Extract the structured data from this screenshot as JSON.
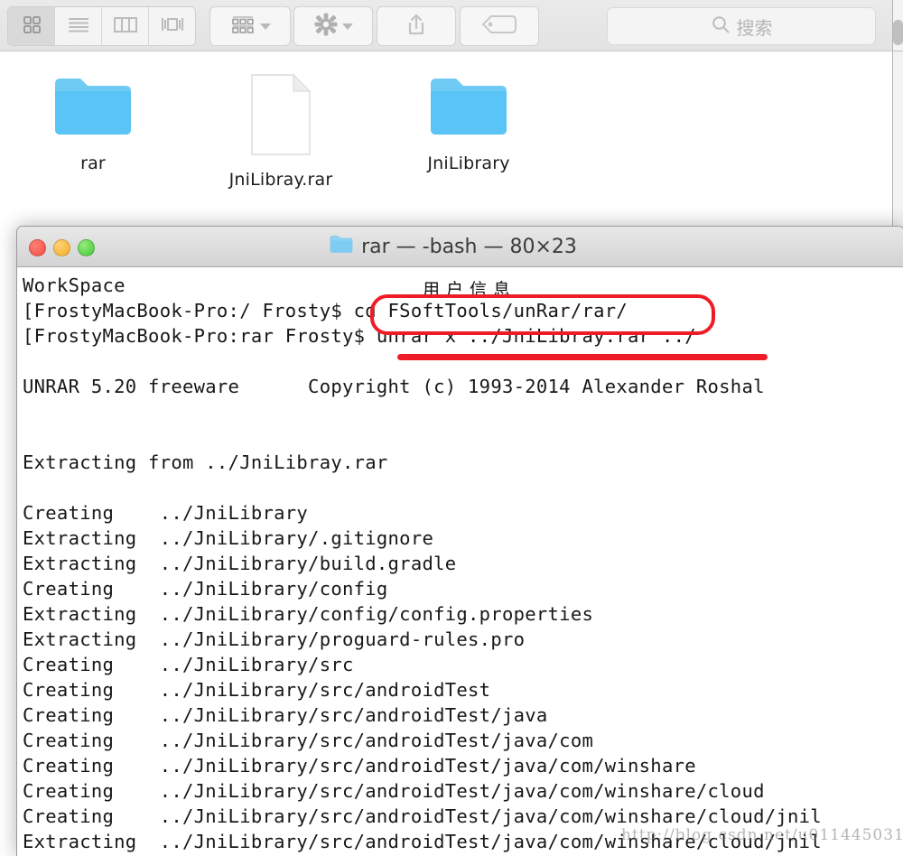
{
  "finder": {
    "toolbar": {
      "view_buttons": [
        {
          "name": "icon-view",
          "icon": "grid-icon",
          "active": true
        },
        {
          "name": "list-view",
          "icon": "list-icon",
          "active": false
        },
        {
          "name": "column-view",
          "icon": "columns-icon",
          "active": false
        },
        {
          "name": "coverflow-view",
          "icon": "coverflow-icon",
          "active": false
        }
      ],
      "arrange_button": {
        "icon": "arrange-icon",
        "chevron": "chevron-down-icon"
      },
      "action_button": {
        "icon": "gear-icon",
        "chevron": "chevron-down-icon"
      },
      "share_button": {
        "icon": "share-icon"
      },
      "tag_button": {
        "icon": "tag-icon"
      },
      "search": {
        "placeholder": "搜索",
        "value": "",
        "icon": "search-icon"
      }
    },
    "files": [
      {
        "label": "rar",
        "type": "folder"
      },
      {
        "label": "JniLibray.rar",
        "type": "document"
      },
      {
        "label": "JniLibrary",
        "type": "folder"
      }
    ]
  },
  "terminal": {
    "title": "rar — -bash — 80×23",
    "title_icon": "folder-icon",
    "traffic_lights": [
      {
        "name": "close-button",
        "color": "#f44b41"
      },
      {
        "name": "minimize-button",
        "color": "#f5ad20"
      },
      {
        "name": "zoom-button",
        "color": "#43c73a"
      }
    ],
    "lines": [
      "WorkSpace",
      "[FrostyMacBook-Pro:/ Frosty$ cd FSoftTools/unRar/rar/",
      "[FrostyMacBook-Pro:rar Frosty$ unrar x ../JniLibray.rar ../",
      "",
      "UNRAR 5.20 freeware      Copyright (c) 1993-2014 Alexander Roshal",
      "",
      "",
      "Extracting from ../JniLibray.rar",
      "",
      "Creating    ../JniLibrary",
      "Extracting  ../JniLibrary/.gitignore",
      "Extracting  ../JniLibrary/build.gradle",
      "Creating    ../JniLibrary/config",
      "Extracting  ../JniLibrary/config/config.properties",
      "Extracting  ../JniLibrary/proguard-rules.pro",
      "Creating    ../JniLibrary/src",
      "Creating    ../JniLibrary/src/androidTest",
      "Creating    ../JniLibrary/src/androidTest/java",
      "Creating    ../JniLibrary/src/androidTest/java/com",
      "Creating    ../JniLibrary/src/androidTest/java/com/winshare",
      "Creating    ../JniLibrary/src/androidTest/java/com/winshare/cloud",
      "Creating    ../JniLibrary/src/androidTest/java/com/winshare/cloud/jnil",
      "Extracting  ../JniLibrary/src/androidTest/java/com/winshare/cloud/jnil"
    ]
  },
  "annotations": {
    "chinese_label": "用户信息",
    "box_color": "#ee1c26",
    "highlighted_command": "cd FSoftTools/unRar/rar/",
    "underlined_command": "unrar x ../JniLibray.rar ../"
  },
  "watermark": "http://blog.csdn.net/u011445031"
}
